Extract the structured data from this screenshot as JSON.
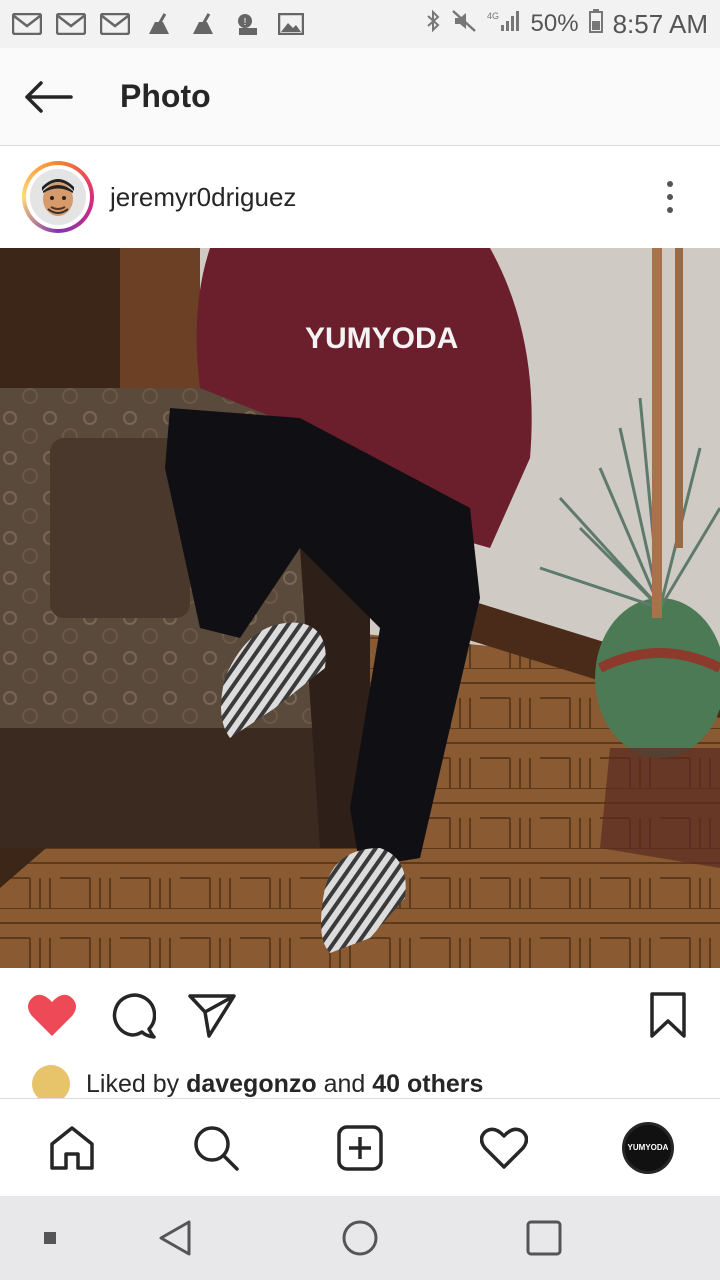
{
  "status_bar": {
    "battery": "50%",
    "time": "8:57 AM",
    "network": "4G LTE",
    "notification_icons": [
      "gmail-icon",
      "gmail-icon",
      "gmail-icon",
      "cleaner-icon",
      "cleaner-icon",
      "robot-icon",
      "gallery-icon"
    ]
  },
  "app_bar": {
    "title": "Photo"
  },
  "post": {
    "username": "jeremyr0driguez",
    "hoodie_brand": "YUMYODA"
  },
  "likes": {
    "prefix": "Liked by ",
    "user": "davegonzo",
    "middle": " and ",
    "others": "40 others"
  },
  "bottom_nav": {
    "profile_label": "YUMYODA"
  },
  "colors": {
    "heart": "#ed4956",
    "text": "#262626",
    "divider": "#dbdbdb"
  }
}
